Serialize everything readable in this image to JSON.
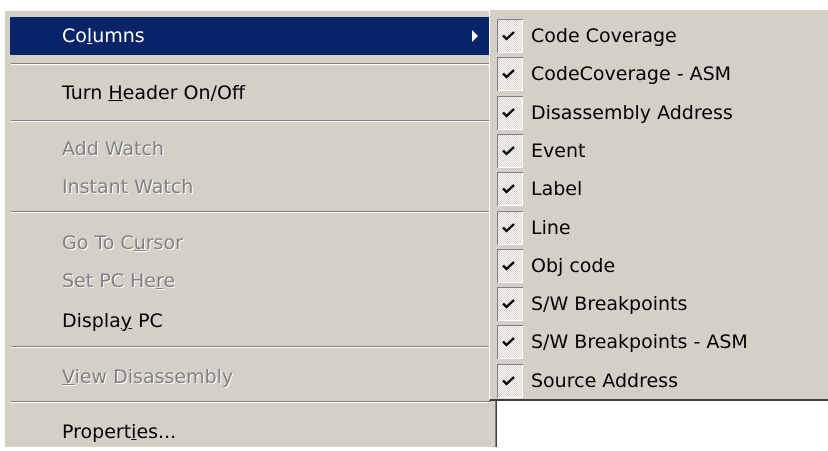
{
  "main_menu": {
    "items": [
      {
        "label_pre": "Co",
        "label_ul": "l",
        "label_post": "umns"
      },
      {
        "label_pre": "Turn ",
        "label_ul": "H",
        "label_post": "eader On/Off"
      },
      {
        "label": "Add Watch"
      },
      {
        "label": "Instant Watch"
      },
      {
        "label_pre": "Go To C",
        "label_ul": "u",
        "label_post": "rsor"
      },
      {
        "label_pre": "Set PC He",
        "label_ul": "r",
        "label_post": "e"
      },
      {
        "label_pre": "Displa",
        "label_ul": "y",
        "label_post": " PC"
      },
      {
        "label_pre": "",
        "label_ul": "V",
        "label_post": "iew Disassembly"
      },
      {
        "label_pre": "Propert",
        "label_ul": "i",
        "label_post": "es..."
      }
    ]
  },
  "columns_submenu": {
    "items": [
      {
        "label": "Code Coverage",
        "checked": true
      },
      {
        "label": "CodeCoverage - ASM",
        "checked": true
      },
      {
        "label": "Disassembly Address",
        "checked": true
      },
      {
        "label": "Event",
        "checked": true
      },
      {
        "label": "Label",
        "checked": true
      },
      {
        "label": "Line",
        "checked": true
      },
      {
        "label": "Obj code",
        "checked": true
      },
      {
        "label": "S/W Breakpoints",
        "checked": true
      },
      {
        "label": "S/W Breakpoints - ASM",
        "checked": true
      },
      {
        "label": "Source Address",
        "checked": true
      }
    ]
  },
  "colors": {
    "menu_bg": "#d4d0c8",
    "highlight": "#0a246a",
    "disabled_text": "#808080"
  }
}
